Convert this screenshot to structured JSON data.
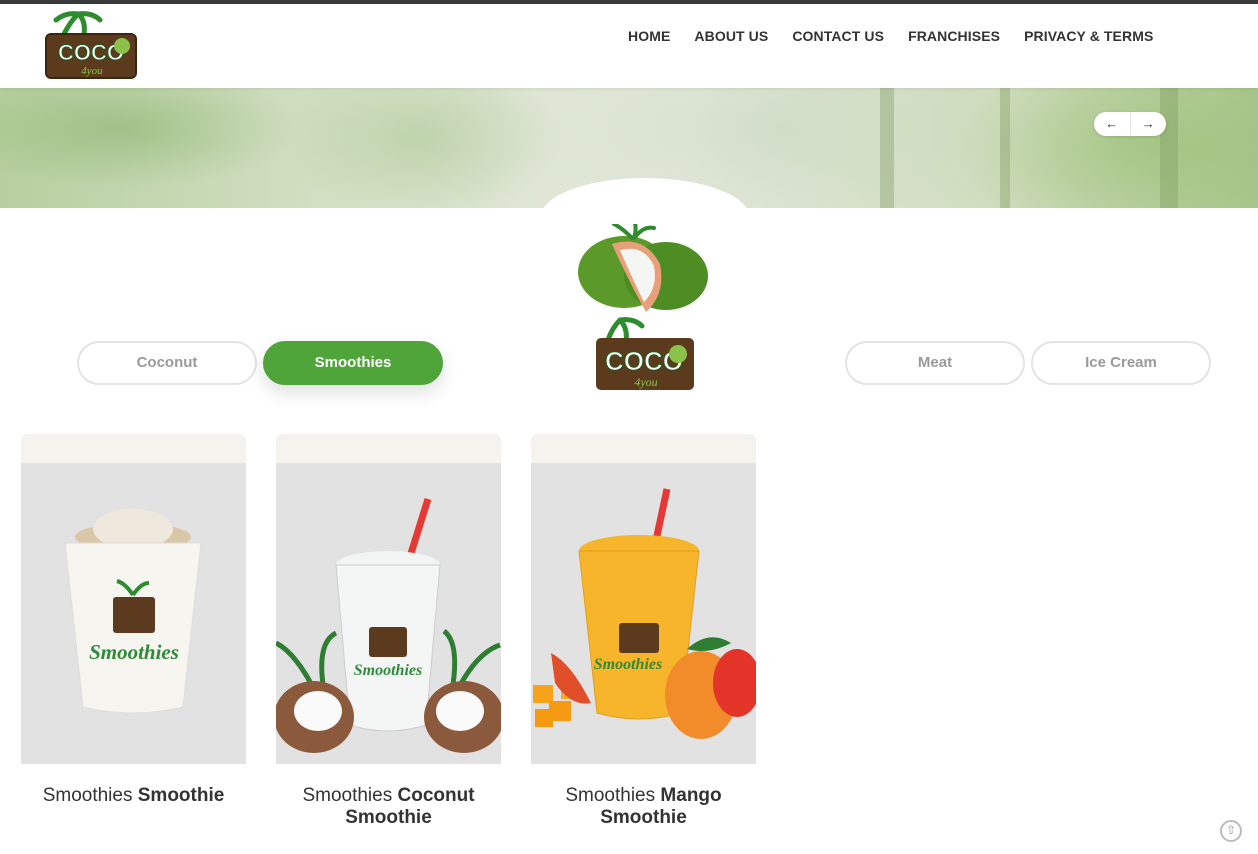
{
  "brand": {
    "logo_text": "COCO",
    "logo_sub": "4you"
  },
  "nav": {
    "items": [
      "HOME",
      "ABOUT US",
      "CONTACT US",
      "FRANCHISES",
      "PRIVACY & TERMS"
    ]
  },
  "slider": {
    "prev": "←",
    "next": "→"
  },
  "tabs": {
    "coconut": "Coconut",
    "smoothies": "Smoothies",
    "meat": "Meat",
    "ice_cream": "Ice Cream",
    "active": "Smoothies"
  },
  "products": [
    {
      "category": "Smoothies",
      "name": "Smoothie",
      "cup_label": "Smoothies",
      "color": "#f2eee6"
    },
    {
      "category": "Smoothies",
      "name": "Coconut Smoothie",
      "cup_label": "Smoothies",
      "color": "#f4f6f6"
    },
    {
      "category": "Smoothies",
      "name": "Mango Smoothie",
      "cup_label": "Smoothies",
      "color": "#f6b52a"
    }
  ],
  "colors": {
    "accent": "#4fa53a",
    "dark": "#333333"
  },
  "icons": {
    "scroll_top": "arrow-up-circle-icon"
  }
}
